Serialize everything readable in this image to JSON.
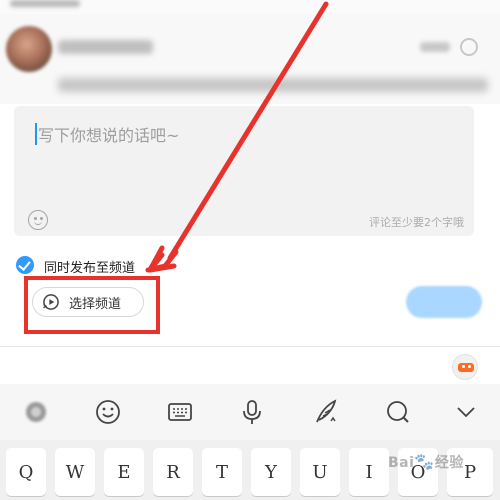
{
  "composer": {
    "placeholder": "写下你想说的话吧~",
    "min_chars_hint": "评论至少要2个字哦"
  },
  "publish": {
    "sync_label": "同时发布至频道",
    "sync_checked": true,
    "choose_channel_label": "选择频道"
  },
  "keyboard": {
    "keys": [
      "Q",
      "W",
      "E",
      "R",
      "T",
      "Y",
      "U",
      "I",
      "O",
      "P"
    ],
    "toolbar": [
      "logo-icon",
      "emoji-icon",
      "keyboard-icon",
      "microphone-icon",
      "handwriting-icon",
      "search-icon",
      "chevron-down-icon"
    ]
  },
  "watermark": {
    "text": "Bai",
    "suffix": "经验"
  },
  "colors": {
    "accent": "#2f9bff",
    "annotation": "#e8332d",
    "send_disabled": "#a9d7ff"
  }
}
